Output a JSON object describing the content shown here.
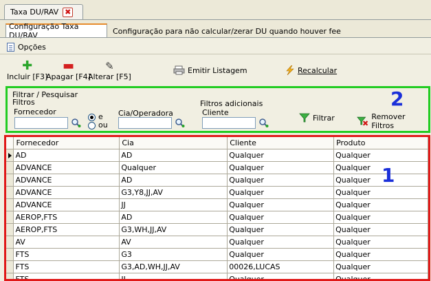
{
  "window": {
    "tab_title": "Taxa DU/RAV"
  },
  "tabs": [
    {
      "label": "Configuração Taxa DU/RAV",
      "active": true
    },
    {
      "label": "Configuração para não calcular/zerar DU quando houver fee",
      "active": false
    }
  ],
  "menu": {
    "opcoes": "Opções"
  },
  "toolbar": {
    "incluir": "Incluir [F3]",
    "apagar": "Apagar [F4]",
    "alterar": "Alterar [F5]",
    "emitir": "Emitir Listagem",
    "recalcular": "Recalcular"
  },
  "filter": {
    "group_title": "Filtrar / Pesquisar",
    "filtros": "Filtros",
    "fornecedor_label": "Fornecedor",
    "fornecedor_value": "",
    "radio_e": "e",
    "radio_ou": "ou",
    "cia_label": "Cia/Operadora",
    "cia_value": "",
    "adicionais": "Filtros adicionais",
    "cliente_label": "Cliente",
    "cliente_value": "",
    "filtrar": "Filtrar",
    "remover": "Remover Filtros",
    "annotation": "2"
  },
  "grid": {
    "annotation": "1",
    "columns": [
      "Fornecedor",
      "Cia",
      "Cliente",
      "Produto"
    ],
    "rows": [
      [
        "AD",
        "AD",
        "Qualquer",
        "Qualquer"
      ],
      [
        "ADVANCE",
        "Qualquer",
        "Qualquer",
        "Qualquer"
      ],
      [
        "ADVANCE",
        "AD",
        "Qualquer",
        "Qualquer"
      ],
      [
        "ADVANCE",
        "G3,Y8,JJ,AV",
        "Qualquer",
        "Qualquer"
      ],
      [
        "ADVANCE",
        "JJ",
        "Qualquer",
        "Qualquer"
      ],
      [
        "AEROP,FTS",
        "AD",
        "Qualquer",
        "Qualquer"
      ],
      [
        "AEROP,FTS",
        "G3,WH,JJ,AV",
        "Qualquer",
        "Qualquer"
      ],
      [
        "AV",
        "AV",
        "Qualquer",
        "Qualquer"
      ],
      [
        "FTS",
        "G3",
        "Qualquer",
        "Qualquer"
      ],
      [
        "FTS",
        "G3,AD,WH,JJ,AV",
        "00026,LUCAS",
        "Qualquer"
      ],
      [
        "FTS",
        "JJ",
        "Qualquer",
        "Qualquer"
      ]
    ]
  },
  "colors": {
    "filter_highlight": "#22cc22",
    "grid_highlight": "#e01818",
    "annotation": "#1a2fd9",
    "tab_accent": "#e68b2c"
  }
}
